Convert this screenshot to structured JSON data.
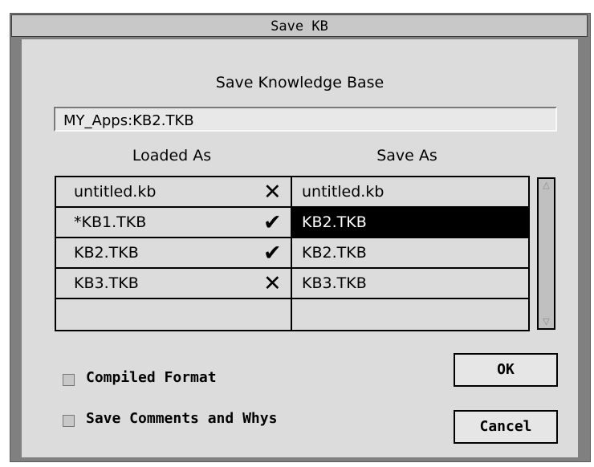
{
  "window": {
    "title": "Save KB"
  },
  "dialog": {
    "heading": "Save Knowledge Base",
    "path_value": "MY_Apps:KB2.TKB",
    "column_loaded": "Loaded As",
    "column_save": "Save As",
    "rows": [
      {
        "loaded_as": "untitled.kb",
        "mark": "✕",
        "mark_icon": "x-icon",
        "save_as": "untitled.kb",
        "selected": false
      },
      {
        "loaded_as": "*KB1.TKB",
        "mark": "✔",
        "mark_icon": "checkmark-icon",
        "save_as": "KB2.TKB",
        "selected": true
      },
      {
        "loaded_as": "KB2.TKB",
        "mark": "✔",
        "mark_icon": "checkmark-icon",
        "save_as": "KB2.TKB",
        "selected": false
      },
      {
        "loaded_as": "KB3.TKB",
        "mark": "✕",
        "mark_icon": "x-icon",
        "save_as": "KB3.TKB",
        "selected": false
      },
      {
        "loaded_as": "",
        "mark": "",
        "mark_icon": "",
        "save_as": "",
        "selected": false
      }
    ],
    "options": {
      "compiled_format": "Compiled Format",
      "save_comments": "Save Comments and Whys"
    },
    "buttons": {
      "ok": "OK",
      "cancel": "Cancel"
    }
  }
}
